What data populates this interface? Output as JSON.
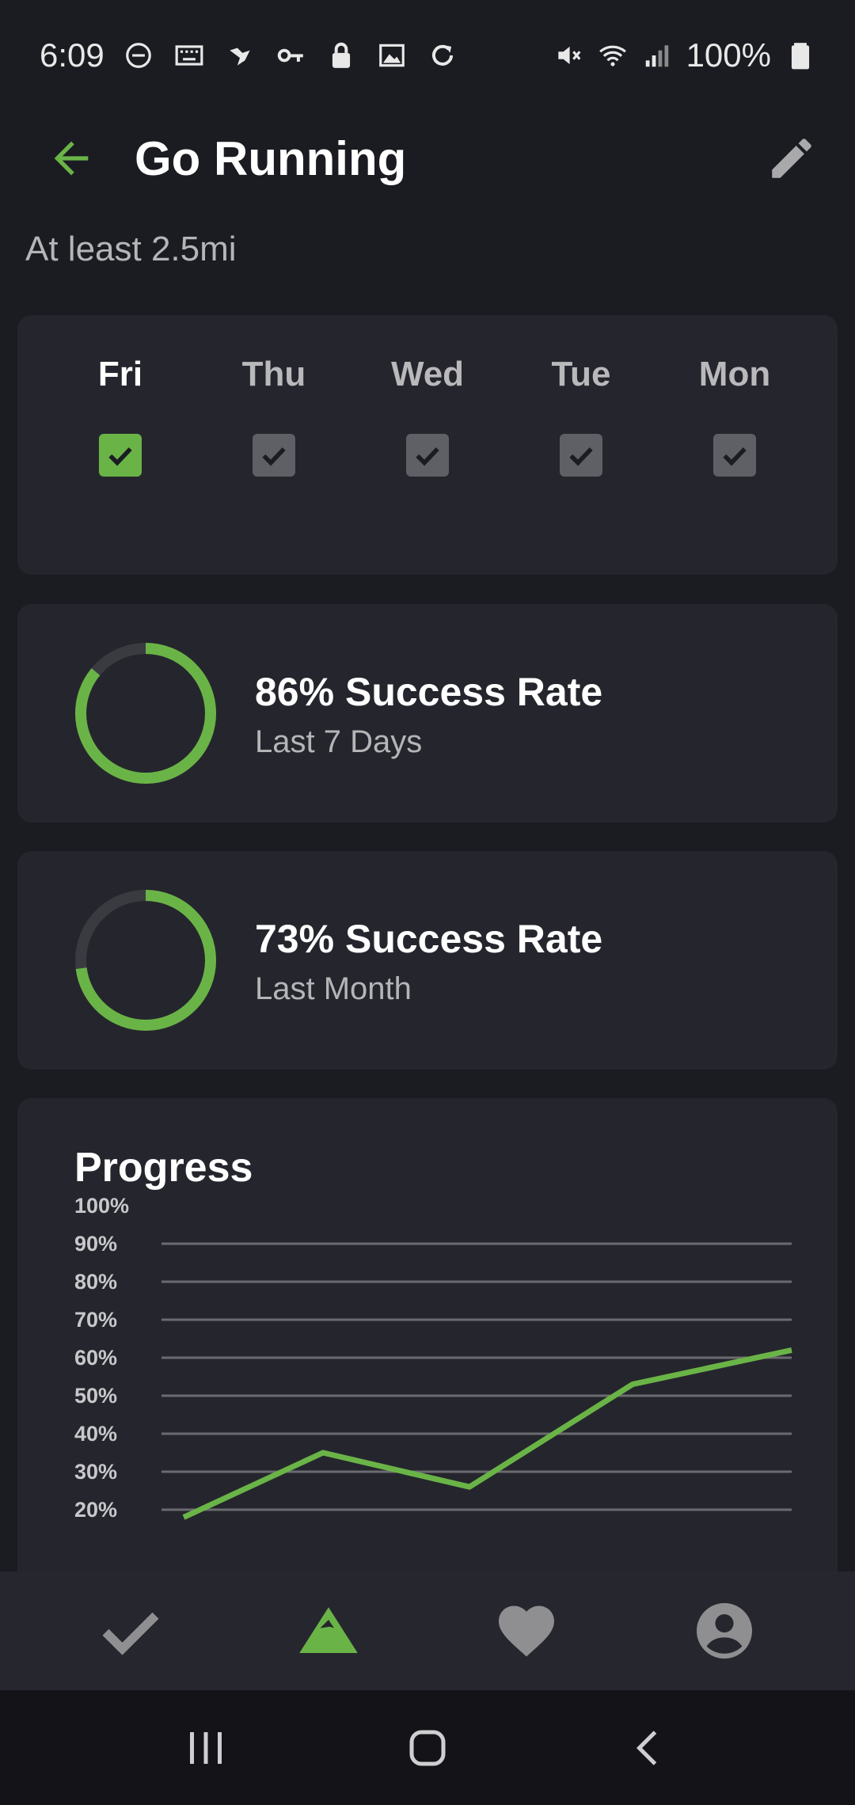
{
  "status_bar": {
    "time": "6:09",
    "battery": "100%"
  },
  "header": {
    "title": "Go Running",
    "subtitle": "At least 2.5mi"
  },
  "days": [
    {
      "label": "Fri",
      "checked": true,
      "today": true
    },
    {
      "label": "Thu",
      "checked": true,
      "today": false
    },
    {
      "label": "Wed",
      "checked": true,
      "today": false
    },
    {
      "label": "Tue",
      "checked": true,
      "today": false
    },
    {
      "label": "Mon",
      "checked": true,
      "today": false
    }
  ],
  "rates": [
    {
      "title": "86% Success Rate",
      "subtitle": "Last 7 Days",
      "value": 0.86
    },
    {
      "title": "73% Success Rate",
      "subtitle": "Last Month",
      "value": 0.73
    }
  ],
  "progress": {
    "title": "Progress"
  },
  "colors": {
    "accent": "#6ab447",
    "background": "#1b1c22",
    "card": "#25262d",
    "ring_track": "#3a3b40"
  },
  "chart_data": {
    "type": "line",
    "y_ticks": [
      "100%",
      "90%",
      "80%",
      "70%",
      "60%",
      "50%",
      "40%",
      "30%",
      "20%"
    ],
    "ylim": [
      20,
      100
    ],
    "grid": true,
    "series": [
      {
        "values": [
          18,
          35,
          26,
          53,
          62
        ]
      }
    ]
  },
  "bottom_nav": {
    "items": [
      {
        "name": "check-icon",
        "active": false
      },
      {
        "name": "mountain-icon",
        "active": true
      },
      {
        "name": "heart-icon",
        "active": false
      },
      {
        "name": "account-icon",
        "active": false
      }
    ]
  }
}
